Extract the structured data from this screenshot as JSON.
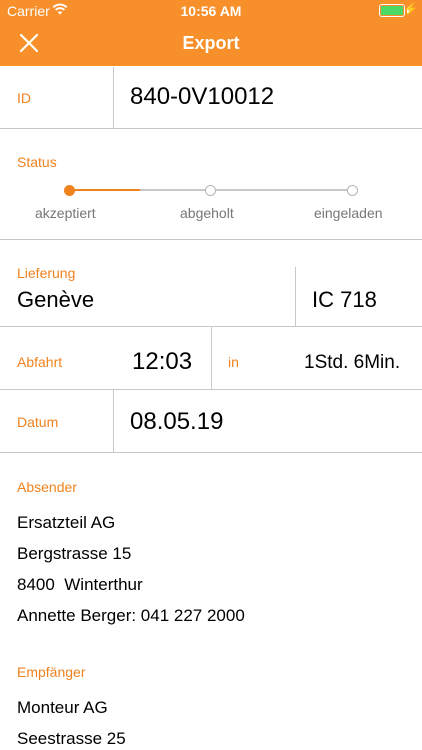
{
  "status_bar": {
    "carrier": "Carrier",
    "time": "10:56 AM"
  },
  "nav": {
    "title": "Export",
    "close_icon": "close-icon"
  },
  "id_field": {
    "label": "ID",
    "value": "840-0V10012"
  },
  "status": {
    "label": "Status",
    "steps": [
      {
        "label": "akzeptiert",
        "active": true
      },
      {
        "label": "abgeholt",
        "active": false
      },
      {
        "label": "eingeladen",
        "active": false
      }
    ],
    "progress_fraction": 0.25
  },
  "delivery": {
    "label": "Lieferung",
    "city": "Genève",
    "train": "IC 718"
  },
  "departure": {
    "label": "Abfahrt",
    "time": "12:03",
    "in_label": "in",
    "in_value": "1Std. 6Min."
  },
  "date": {
    "label": "Datum",
    "value": "08.05.19"
  },
  "sender": {
    "label": "Absender",
    "lines": [
      "Ersatzteil AG",
      "Bergstrasse 15",
      "8400  Winterthur",
      "Annette Berger: 041 227 2000"
    ]
  },
  "recipient": {
    "label": "Empfänger",
    "lines": [
      "Monteur AG",
      "Seestrasse 25"
    ]
  },
  "colors": {
    "accent": "#f7902b",
    "label": "#f0821e",
    "divider": "#c8c8c8",
    "battery": "#4cd964"
  }
}
